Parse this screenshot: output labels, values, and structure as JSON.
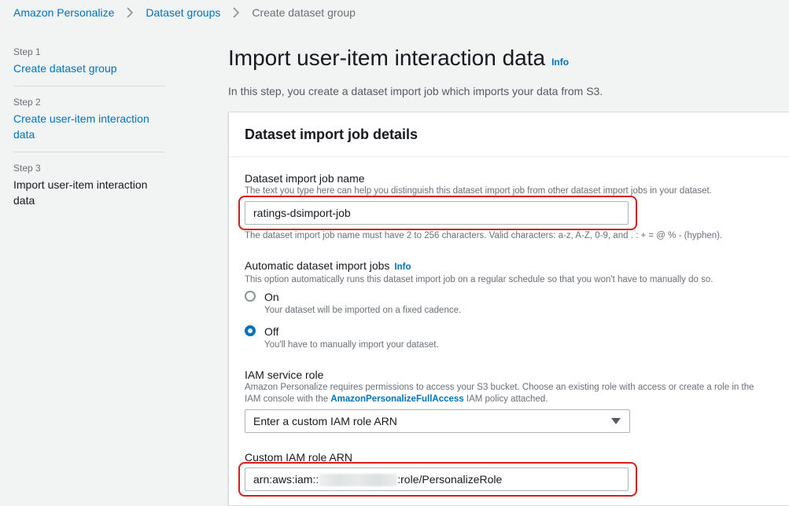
{
  "breadcrumb": {
    "items": [
      "Amazon Personalize",
      "Dataset groups",
      "Create dataset group"
    ]
  },
  "steps": [
    {
      "num": "Step 1",
      "label": "Create dataset group"
    },
    {
      "num": "Step 2",
      "label": "Create user-item interaction data"
    },
    {
      "num": "Step 3",
      "label": "Import user-item interaction data"
    }
  ],
  "page": {
    "title": "Import user-item interaction data",
    "info": "Info",
    "description": "In this step, you create a dataset import job which imports your data from S3."
  },
  "panel": {
    "title": "Dataset import job details",
    "job_name": {
      "label": "Dataset import job name",
      "description": "The text you type here can help you distinguish this dataset import job from other dataset import jobs in your dataset.",
      "value": "ratings-dsimport-job",
      "constraint": "The dataset import job name must have 2 to 256 characters. Valid characters: a-z, A-Z, 0-9, and . : + = @ % - (hyphen)."
    },
    "auto_import": {
      "label": "Automatic dataset import jobs",
      "info": "Info",
      "description": "This option automatically runs this dataset import job on a regular schedule so that you won't have to manually do so.",
      "options": [
        {
          "label": "On",
          "description": "Your dataset will be imported on a fixed cadence.",
          "selected": false
        },
        {
          "label": "Off",
          "description": "You'll have to manually import your dataset.",
          "selected": true
        }
      ]
    },
    "iam_role": {
      "label": "IAM service role",
      "description_prefix": "Amazon Personalize requires permissions to access your S3 bucket. Choose an existing role with access or create a role in the IAM console with the ",
      "policy_name": "AmazonPersonalizeFullAccess",
      "description_suffix": " IAM policy attached.",
      "selected": "Enter a custom IAM role ARN"
    },
    "custom_arn": {
      "label": "Custom IAM role ARN",
      "value_prefix": "arn:aws:iam::",
      "value_suffix": ":role/PersonalizeRole"
    }
  },
  "colors": {
    "link": "#0073bb",
    "highlight": "#d91c1c",
    "background": "#f2f3f3"
  }
}
